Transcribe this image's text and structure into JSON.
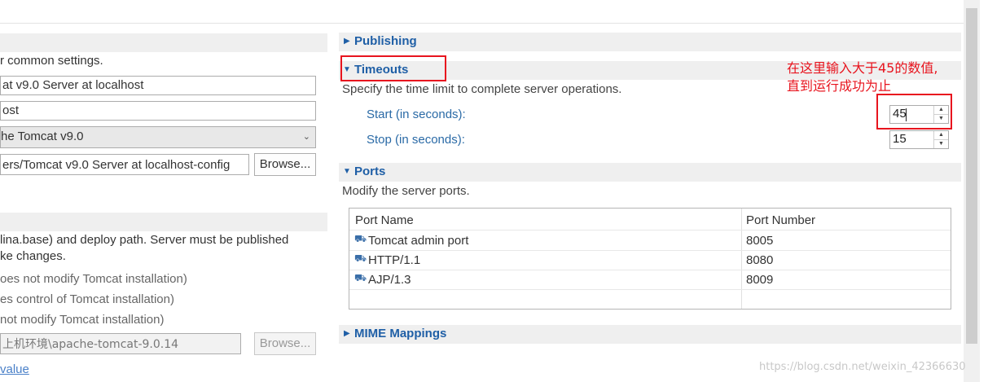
{
  "left": {
    "intro_text": "r common settings.",
    "server_name_value": "at v9.0 Server at localhost",
    "host_name_value": "ost",
    "runtime_env_value": "he Tomcat v9.0",
    "config_path_value": "ers/Tomcat v9.0 Server at localhost-config",
    "browse_label": "Browse...",
    "locations_desc_line1": "lina.base) and deploy path. Server must be published",
    "locations_desc_line2": "ke changes.",
    "radio_options": [
      "oes not modify Tomcat installation)",
      "es control of Tomcat installation)",
      "not modify Tomcat installation)"
    ],
    "server_path_value": "上机环境\\apache-tomcat-9.0.14",
    "browse2_label": "Browse...",
    "default_link": "value"
  },
  "right": {
    "publishing_title": "Publishing",
    "timeouts_title": "Timeouts",
    "timeouts_desc": "Specify the time limit to complete server operations.",
    "start_label": "Start (in seconds):",
    "start_value": "45",
    "stop_label": "Stop (in seconds):",
    "stop_value": "15",
    "ports_title": "Ports",
    "ports_desc": "Modify the server ports.",
    "ports_table": {
      "headers": [
        "Port Name",
        "Port Number"
      ],
      "rows": [
        {
          "name": "Tomcat admin port",
          "number": "8005"
        },
        {
          "name": "HTTP/1.1",
          "number": "8080"
        },
        {
          "name": "AJP/1.3",
          "number": "8009"
        }
      ]
    },
    "mime_title": "MIME Mappings"
  },
  "annotation": {
    "line1": "在这里输入大于45的数值,",
    "line2": "直到运行成功为止",
    "color": "#e8141e"
  },
  "watermark": "https://blog.csdn.net/weixin_42366630",
  "colors": {
    "section_title": "#1f5fa6",
    "field_label": "#2a6aa6",
    "section_bg": "#efefef"
  },
  "icons": {
    "collapsed": "triangle-right-icon",
    "expanded": "triangle-down-icon",
    "port": "port-icon",
    "combo": "chevron-down-icon"
  }
}
